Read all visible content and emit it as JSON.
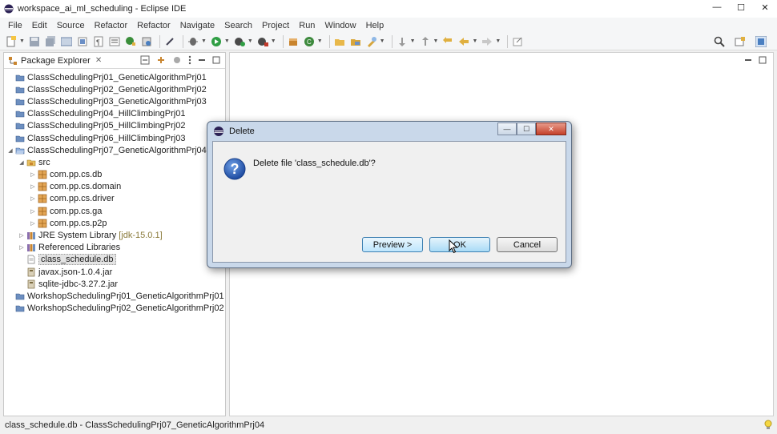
{
  "window": {
    "title": "workspace_ai_ml_scheduling - Eclipse IDE",
    "controls": [
      "—",
      "☐",
      "✕"
    ]
  },
  "menu": [
    "File",
    "Edit",
    "Source",
    "Refactor",
    "Refactor",
    "Navigate",
    "Search",
    "Project",
    "Run",
    "Window",
    "Help"
  ],
  "package_explorer": {
    "tab_label": "Package Explorer",
    "close_glyph": "✕",
    "items": [
      {
        "label": "ClassSchedulingPrj01_GeneticAlgorithmPrj01",
        "icon": "project-icon",
        "indent": 0,
        "twisty": ""
      },
      {
        "label": "ClassSchedulingPrj02_GeneticAlgorithmPrj02",
        "icon": "project-icon",
        "indent": 0,
        "twisty": ""
      },
      {
        "label": "ClassSchedulingPrj03_GeneticAlgorithmPrj03",
        "icon": "project-icon",
        "indent": 0,
        "twisty": ""
      },
      {
        "label": "ClassSchedulingPrj04_HillClimbingPrj01",
        "icon": "project-icon",
        "indent": 0,
        "twisty": ""
      },
      {
        "label": "ClassSchedulingPrj05_HillClimbingPrj02",
        "icon": "project-icon",
        "indent": 0,
        "twisty": ""
      },
      {
        "label": "ClassSchedulingPrj06_HillClimbingPrj03",
        "icon": "project-icon",
        "indent": 0,
        "twisty": ""
      },
      {
        "label": "ClassSchedulingPrj07_GeneticAlgorithmPrj04",
        "icon": "open-project-icon",
        "indent": 0,
        "twisty": "◢"
      },
      {
        "label": "src",
        "icon": "source-folder-icon",
        "indent": 1,
        "twisty": "◢"
      },
      {
        "label": "com.pp.cs.db",
        "icon": "package-icon",
        "indent": 2,
        "twisty": "▷"
      },
      {
        "label": "com.pp.cs.domain",
        "icon": "package-icon",
        "indent": 2,
        "twisty": "▷"
      },
      {
        "label": "com.pp.cs.driver",
        "icon": "package-icon",
        "indent": 2,
        "twisty": "▷"
      },
      {
        "label": "com.pp.cs.ga",
        "icon": "package-icon",
        "indent": 2,
        "twisty": "▷"
      },
      {
        "label": "com.pp.cs.p2p",
        "icon": "package-icon",
        "indent": 2,
        "twisty": "▷"
      },
      {
        "label": "JRE System Library",
        "decoration": "[jdk-15.0.1]",
        "icon": "library-icon",
        "indent": 1,
        "twisty": "▷"
      },
      {
        "label": "Referenced Libraries",
        "icon": "library-icon",
        "indent": 1,
        "twisty": "▷"
      },
      {
        "label": "class_schedule.db",
        "icon": "file-icon",
        "indent": 1,
        "twisty": "",
        "selected": true
      },
      {
        "label": "javax.json-1.0.4.jar",
        "icon": "jar-icon",
        "indent": 1,
        "twisty": ""
      },
      {
        "label": "sqlite-jdbc-3.27.2.jar",
        "icon": "jar-icon",
        "indent": 1,
        "twisty": ""
      },
      {
        "label": "WorkshopSchedulingPrj01_GeneticAlgorithmPrj01",
        "icon": "project-icon",
        "indent": 0,
        "twisty": ""
      },
      {
        "label": "WorkshopSchedulingPrj02_GeneticAlgorithmPrj02",
        "icon": "project-icon",
        "indent": 0,
        "twisty": ""
      }
    ]
  },
  "dialog": {
    "title": "Delete",
    "message": "Delete file 'class_schedule.db'?",
    "buttons": {
      "preview": "Preview >",
      "ok": "OK",
      "cancel": "Cancel"
    },
    "controls": [
      "—",
      "☐",
      "✕"
    ]
  },
  "status_bar": {
    "text": "class_schedule.db - ClassSchedulingPrj07_GeneticAlgorithmPrj04"
  },
  "colors": {
    "project": "#6d8fc0",
    "package": "#c9852f",
    "selection": "#e3e3e3",
    "dialog_frame": "#c9d8ea",
    "ok_button": "#a9dbf6"
  }
}
